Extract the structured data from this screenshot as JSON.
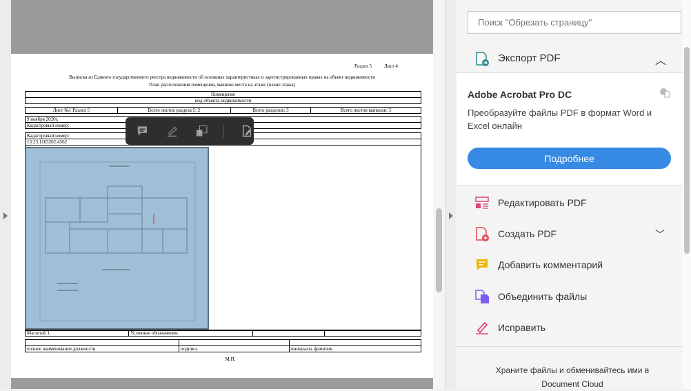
{
  "document": {
    "header_right_section": "Раздел 5",
    "header_right_sheet": "Лист 4",
    "title": "Выписка из Единого государственного реестра недвижимости об основных характеристиках и зарегистрированных правах на объект недвижимости",
    "subtitle": "План расположения помещения, машино-места на этаже (плане этажа)",
    "object_type": "Помещение",
    "object_type_caption": "вид объекта недвижимости",
    "sheet_info": [
      "Лист №1  Раздел 5",
      "Всего листов раздела 5: 2",
      "Всего разделов: 3",
      "Всего листов выписки: 5"
    ],
    "date": "9 ноября 2020г.",
    "cadastral_label_1": "Кадастровый номер:",
    "cadastral_label_2": "Кадастровый номер:",
    "cadastral_number": "13:23:1103202:4562",
    "scale": "Масштаб 1:",
    "legend": "Условные обозначения:",
    "sign_cols": [
      "полное наименование должности",
      "подпись",
      "инициалы, фамилия"
    ],
    "stamp": "М.П."
  },
  "panel": {
    "search_placeholder": "Поиск \"Обрезать страницу\"",
    "export_title": "Экспорт PDF",
    "product": "Adobe Acrobat Pro DC",
    "description": "Преобразуйте файлы PDF в формат Word и Excel онлайн",
    "more_button": "Подробнее",
    "tools": [
      {
        "label": "Редактировать PDF",
        "color": "#e0457b"
      },
      {
        "label": "Создать PDF",
        "color": "#e34850"
      },
      {
        "label": "Добавить комментарий",
        "color": "#f0b400"
      },
      {
        "label": "Объединить файлы",
        "color": "#7b5cf0"
      },
      {
        "label": "Исправить",
        "color": "#e0457b"
      }
    ],
    "footer": "Храните файлы и обменивайтесь ими в Document Cloud"
  }
}
